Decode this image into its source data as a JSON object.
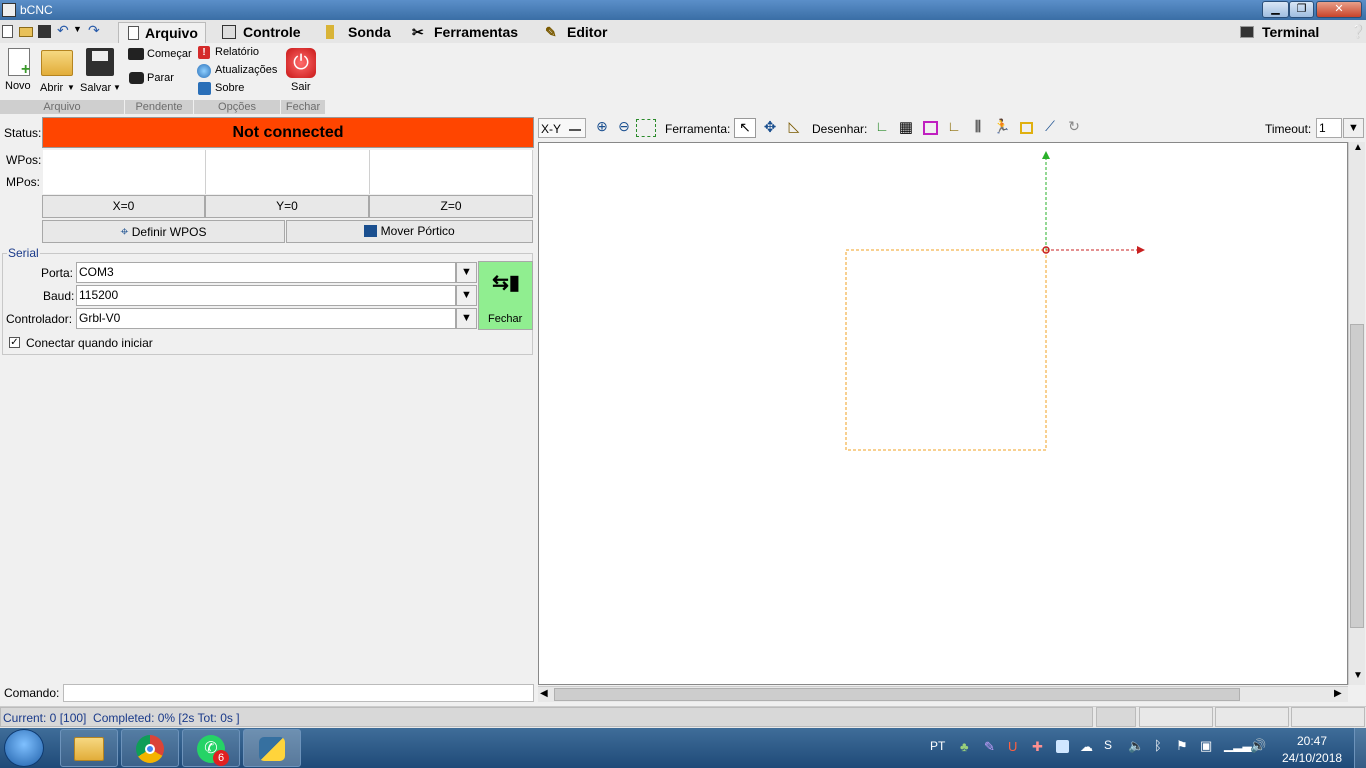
{
  "window": {
    "title": "bCNC"
  },
  "tabs": [
    {
      "label": "Arquivo"
    },
    {
      "label": "Controle"
    },
    {
      "label": "Sonda"
    },
    {
      "label": "Ferramentas"
    },
    {
      "label": "Editor"
    },
    {
      "label": "Terminal"
    }
  ],
  "ribbon": {
    "novo": "Novo",
    "abrir": "Abrir",
    "salvar": "Salvar",
    "comecar": "Começar",
    "parar": "Parar",
    "relatorio": "Relatório",
    "atualizacoes": "Atualizações",
    "sobre": "Sobre",
    "sair": "Sair",
    "groups": [
      "Arquivo",
      "Pendente",
      "Opções",
      "Fechar"
    ]
  },
  "status": {
    "label": "Status:",
    "value": "Not connected",
    "color": "#ff4500",
    "wpos_label": "WPos:",
    "mpos_label": "MPos:"
  },
  "axes": {
    "x": "X=0",
    "y": "Y=0",
    "z": "Z=0"
  },
  "actions": {
    "definir": "Definir WPOS",
    "mover": "Mover Pórtico"
  },
  "serial": {
    "title": "Serial",
    "porta_label": "Porta:",
    "porta": "COM3",
    "baud_label": "Baud:",
    "baud": "115200",
    "controlador_label": "Controlador:",
    "controlador": "Grbl-V0",
    "connect_label": "Fechar",
    "connect_color": "#90ee90",
    "auto_label": "Conectar quando iniciar",
    "auto_checked": true
  },
  "comando": {
    "label": "Comando:",
    "value": ""
  },
  "toolbar": {
    "view": "X-Y",
    "ferramenta": "Ferramenta:",
    "desenhar": "Desenhar:",
    "timeout_label": "Timeout:",
    "timeout": "1"
  },
  "statusbar": {
    "text": "Current: 0 [100]  Completed: 0% [2s Tot: 0s ]"
  },
  "taskbar": {
    "lang": "PT",
    "time": "20:47",
    "date": "24/10/2018",
    "whatsapp_badge": "6"
  }
}
